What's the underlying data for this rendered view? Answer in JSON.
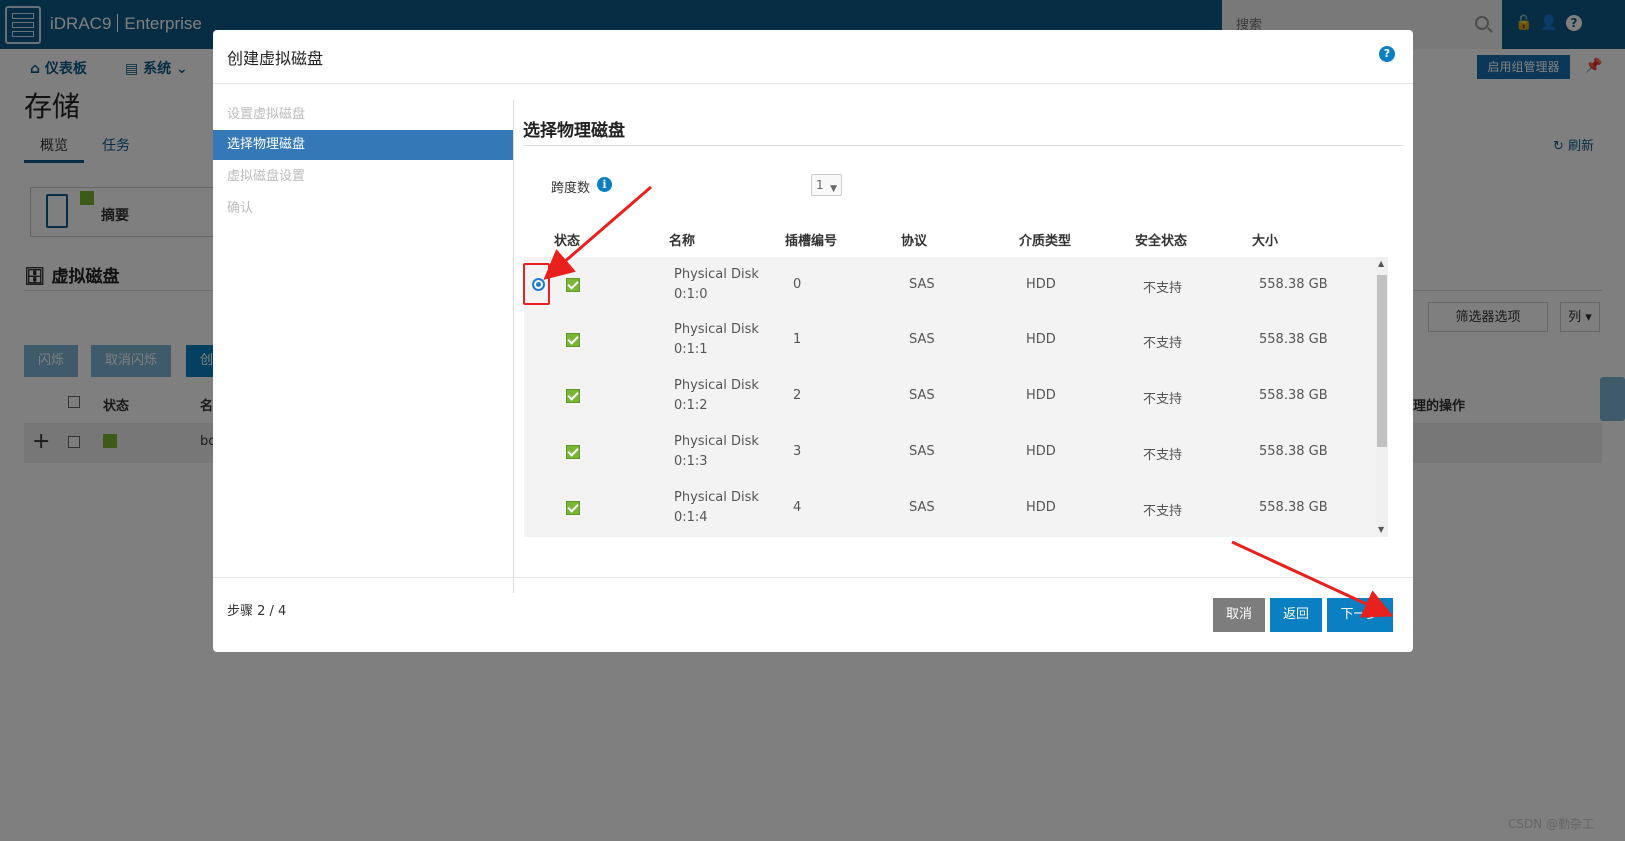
{
  "app": {
    "title": "iDRAC9",
    "edition": "Enterprise",
    "search_placeholder": "搜索"
  },
  "nav": {
    "dashboard": "仪表板",
    "system": "系统",
    "group_manager": "启用组管理器"
  },
  "page": {
    "title": "存储",
    "tabs": [
      "概览",
      "任务"
    ],
    "refresh": "刷新",
    "summary_label": "摘要",
    "virtual_disks_heading": "虚拟磁盘",
    "buttons": [
      "闪烁",
      "取消闪烁",
      "创"
    ],
    "filter_options": "筛选器选项",
    "columns": "列",
    "table_headers": [
      "状态",
      "名"
    ],
    "ops_header": "理的操作",
    "row_name_fragment": "bo"
  },
  "modal": {
    "title": "创建虚拟磁盘",
    "steps": [
      "设置虚拟磁盘",
      "选择物理磁盘",
      "虚拟磁盘设置",
      "确认"
    ],
    "active_step": 1,
    "section_title": "选择物理磁盘",
    "span_label": "跨度数",
    "span_value": "1",
    "headers": [
      "状态",
      "名称",
      "插槽编号",
      "协议",
      "介质类型",
      "安全状态",
      "大小"
    ],
    "disks": [
      {
        "name_line1": "Physical Disk",
        "name_line2": "0:1:0",
        "slot": "0",
        "protocol": "SAS",
        "media": "HDD",
        "security": "不支持",
        "size": "558.38 GB",
        "selected": true
      },
      {
        "name_line1": "Physical Disk",
        "name_line2": "0:1:1",
        "slot": "1",
        "protocol": "SAS",
        "media": "HDD",
        "security": "不支持",
        "size": "558.38 GB",
        "selected": false
      },
      {
        "name_line1": "Physical Disk",
        "name_line2": "0:1:2",
        "slot": "2",
        "protocol": "SAS",
        "media": "HDD",
        "security": "不支持",
        "size": "558.38 GB",
        "selected": false
      },
      {
        "name_line1": "Physical Disk",
        "name_line2": "0:1:3",
        "slot": "3",
        "protocol": "SAS",
        "media": "HDD",
        "security": "不支持",
        "size": "558.38 GB",
        "selected": false
      },
      {
        "name_line1": "Physical Disk",
        "name_line2": "0:1:4",
        "slot": "4",
        "protocol": "SAS",
        "media": "HDD",
        "security": "不支持",
        "size": "558.38 GB",
        "selected": false
      }
    ],
    "step_counter": "步骤 2 / 4",
    "cancel": "取消",
    "back": "返回",
    "next": "下一步"
  },
  "watermark": "CSDN @勤杂工",
  "colors": {
    "topbar": "#0e5a88",
    "accent": "#0a7fc2",
    "active_step": "#3478b8",
    "status_ok": "#7ab536",
    "annotation": "#e8211e"
  }
}
